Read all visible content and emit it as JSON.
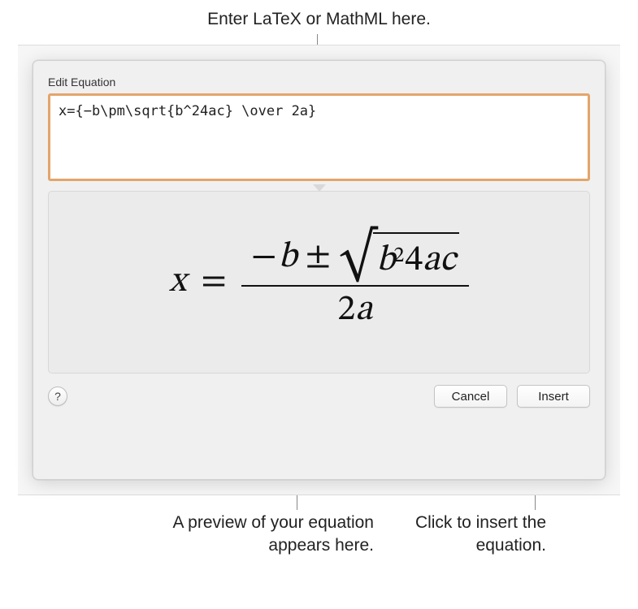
{
  "callouts": {
    "top": "Enter LaTeX or MathML here.",
    "preview": "A preview of your equation appears here.",
    "insert": "Click to insert the equation."
  },
  "dialog": {
    "title": "Edit Equation",
    "input_value": "x={−b\\pm\\sqrt{b^24ac} \\over 2a}",
    "buttons": {
      "help": "?",
      "cancel": "Cancel",
      "insert": "Insert"
    }
  },
  "equation_preview": {
    "lhs_var": "x",
    "equals": "=",
    "minus": "−",
    "var_b": "b",
    "pm": "±",
    "radical": "√",
    "sqrt_b": "b",
    "sqrt_exp": "2",
    "sqrt_four": "4",
    "sqrt_a": "a",
    "sqrt_c": "c",
    "den_two": "2",
    "den_a": "a"
  }
}
